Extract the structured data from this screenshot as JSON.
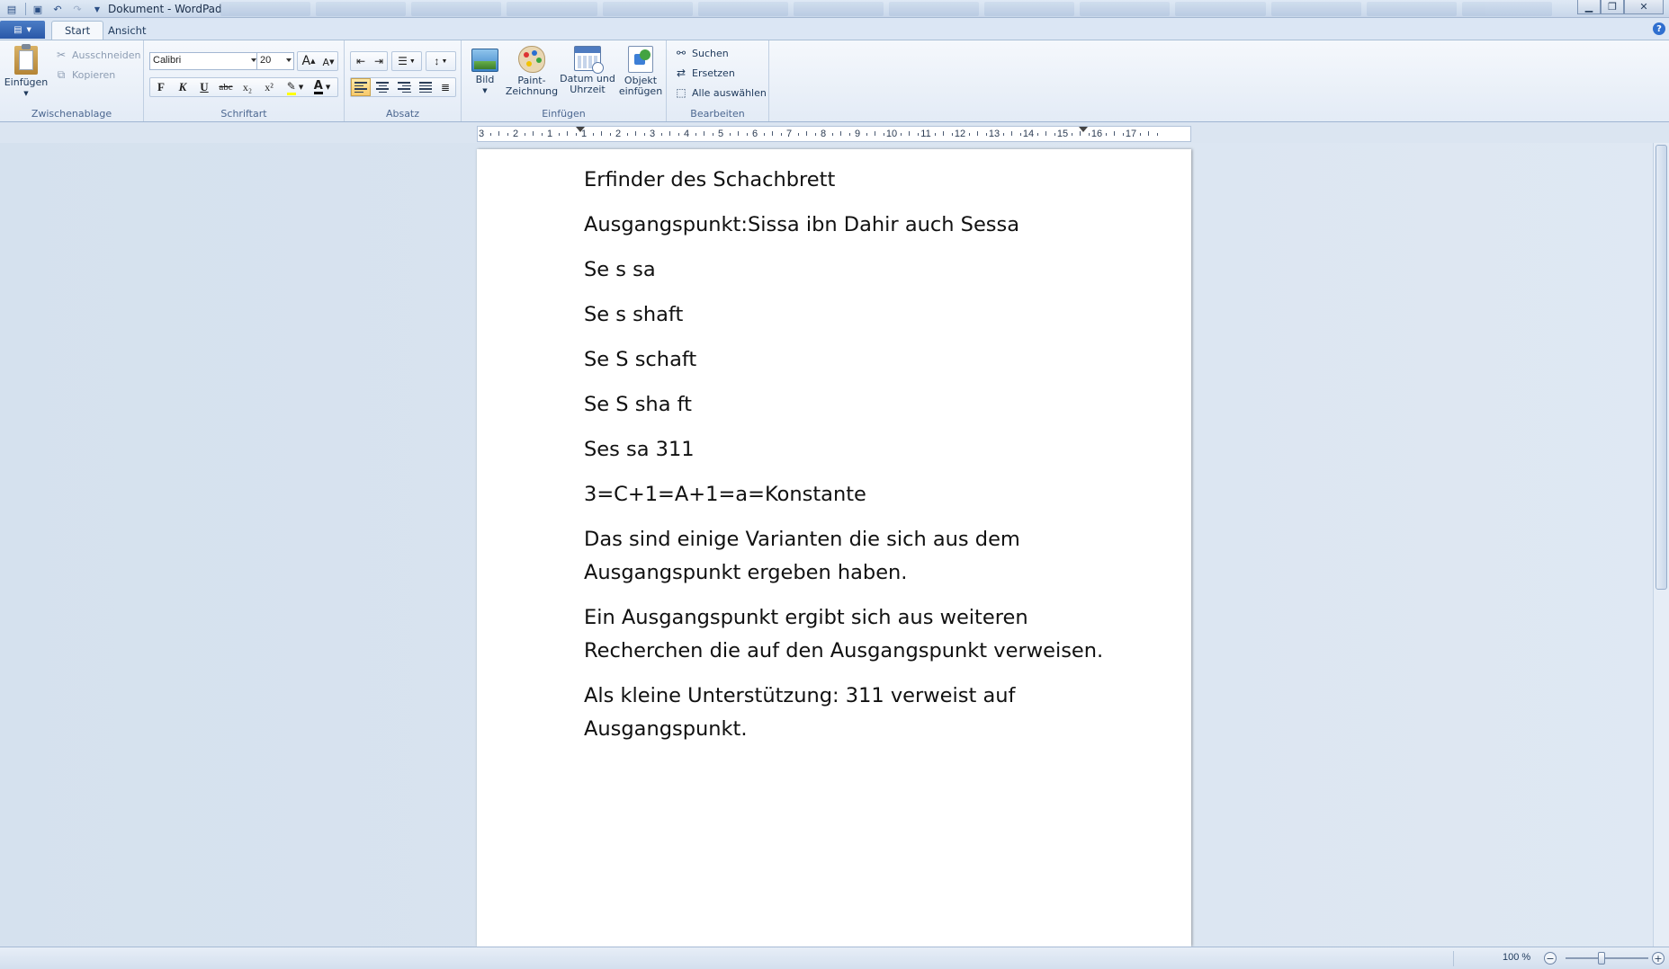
{
  "window": {
    "title": "Dokument - WordPad"
  },
  "tabs": {
    "start": "Start",
    "view": "Ansicht"
  },
  "ribbon": {
    "clipboard": {
      "label": "Zwischenablage",
      "paste": "Einfügen",
      "cut": "Ausschneiden",
      "copy": "Kopieren"
    },
    "font": {
      "label": "Schriftart",
      "family": "Calibri",
      "size": "20",
      "bold": "F",
      "italic": "K",
      "underline": "U",
      "strike": "abc",
      "sub": "x₂",
      "sup": "x²",
      "grow": "A",
      "shrink": "A",
      "color": "A"
    },
    "paragraph": {
      "label": "Absatz"
    },
    "insert": {
      "label": "Einfügen",
      "picture": "Bild",
      "paint_l1": "Paint-",
      "paint_l2": "Zeichnung",
      "date_l1": "Datum und",
      "date_l2": "Uhrzeit",
      "object_l1": "Objekt",
      "object_l2": "einfügen"
    },
    "edit": {
      "label": "Bearbeiten",
      "find": "Suchen",
      "replace": "Ersetzen",
      "select_all": "Alle auswählen"
    }
  },
  "ruler": {
    "labels": [
      "3",
      "2",
      "1",
      "1",
      "2",
      "3",
      "4",
      "5",
      "6",
      "7",
      "8",
      "9",
      "10",
      "11",
      "12",
      "13",
      "14",
      "15",
      "16",
      "17"
    ]
  },
  "document": {
    "paragraphs": [
      [
        "Erfinder des Schachbrett"
      ],
      [
        "Ausgangspunkt:Sissa ibn Dahir auch Sessa"
      ],
      [
        "Se s sa"
      ],
      [
        "Se s shaft"
      ],
      [
        "Se S schaft"
      ],
      [
        "Se S sha ft"
      ],
      [
        "Ses sa 311"
      ],
      [
        "3=C+1=A+1=a=Konstante"
      ],
      [
        "Das sind einige Varianten die sich aus dem",
        "Ausgangspunkt ergeben haben."
      ],
      [
        "Ein Ausgangspunkt ergibt sich aus weiteren",
        "Recherchen die auf den Ausgangspunkt verweisen."
      ],
      [
        "Als kleine Unterstützung:  311 verweist auf",
        "Ausgangspunkt."
      ]
    ]
  },
  "status": {
    "zoom": "100 %",
    "zoom_level_percent": 100,
    "zoom_out": "−",
    "zoom_in": "+"
  },
  "icons": [
    "save-icon",
    "undo-icon",
    "redo-icon",
    "paste-icon",
    "cut-icon",
    "copy-icon",
    "picture-icon",
    "paint-icon",
    "calendar-icon",
    "object-icon",
    "binoculars-icon",
    "replace-icon",
    "select-all-icon"
  ]
}
